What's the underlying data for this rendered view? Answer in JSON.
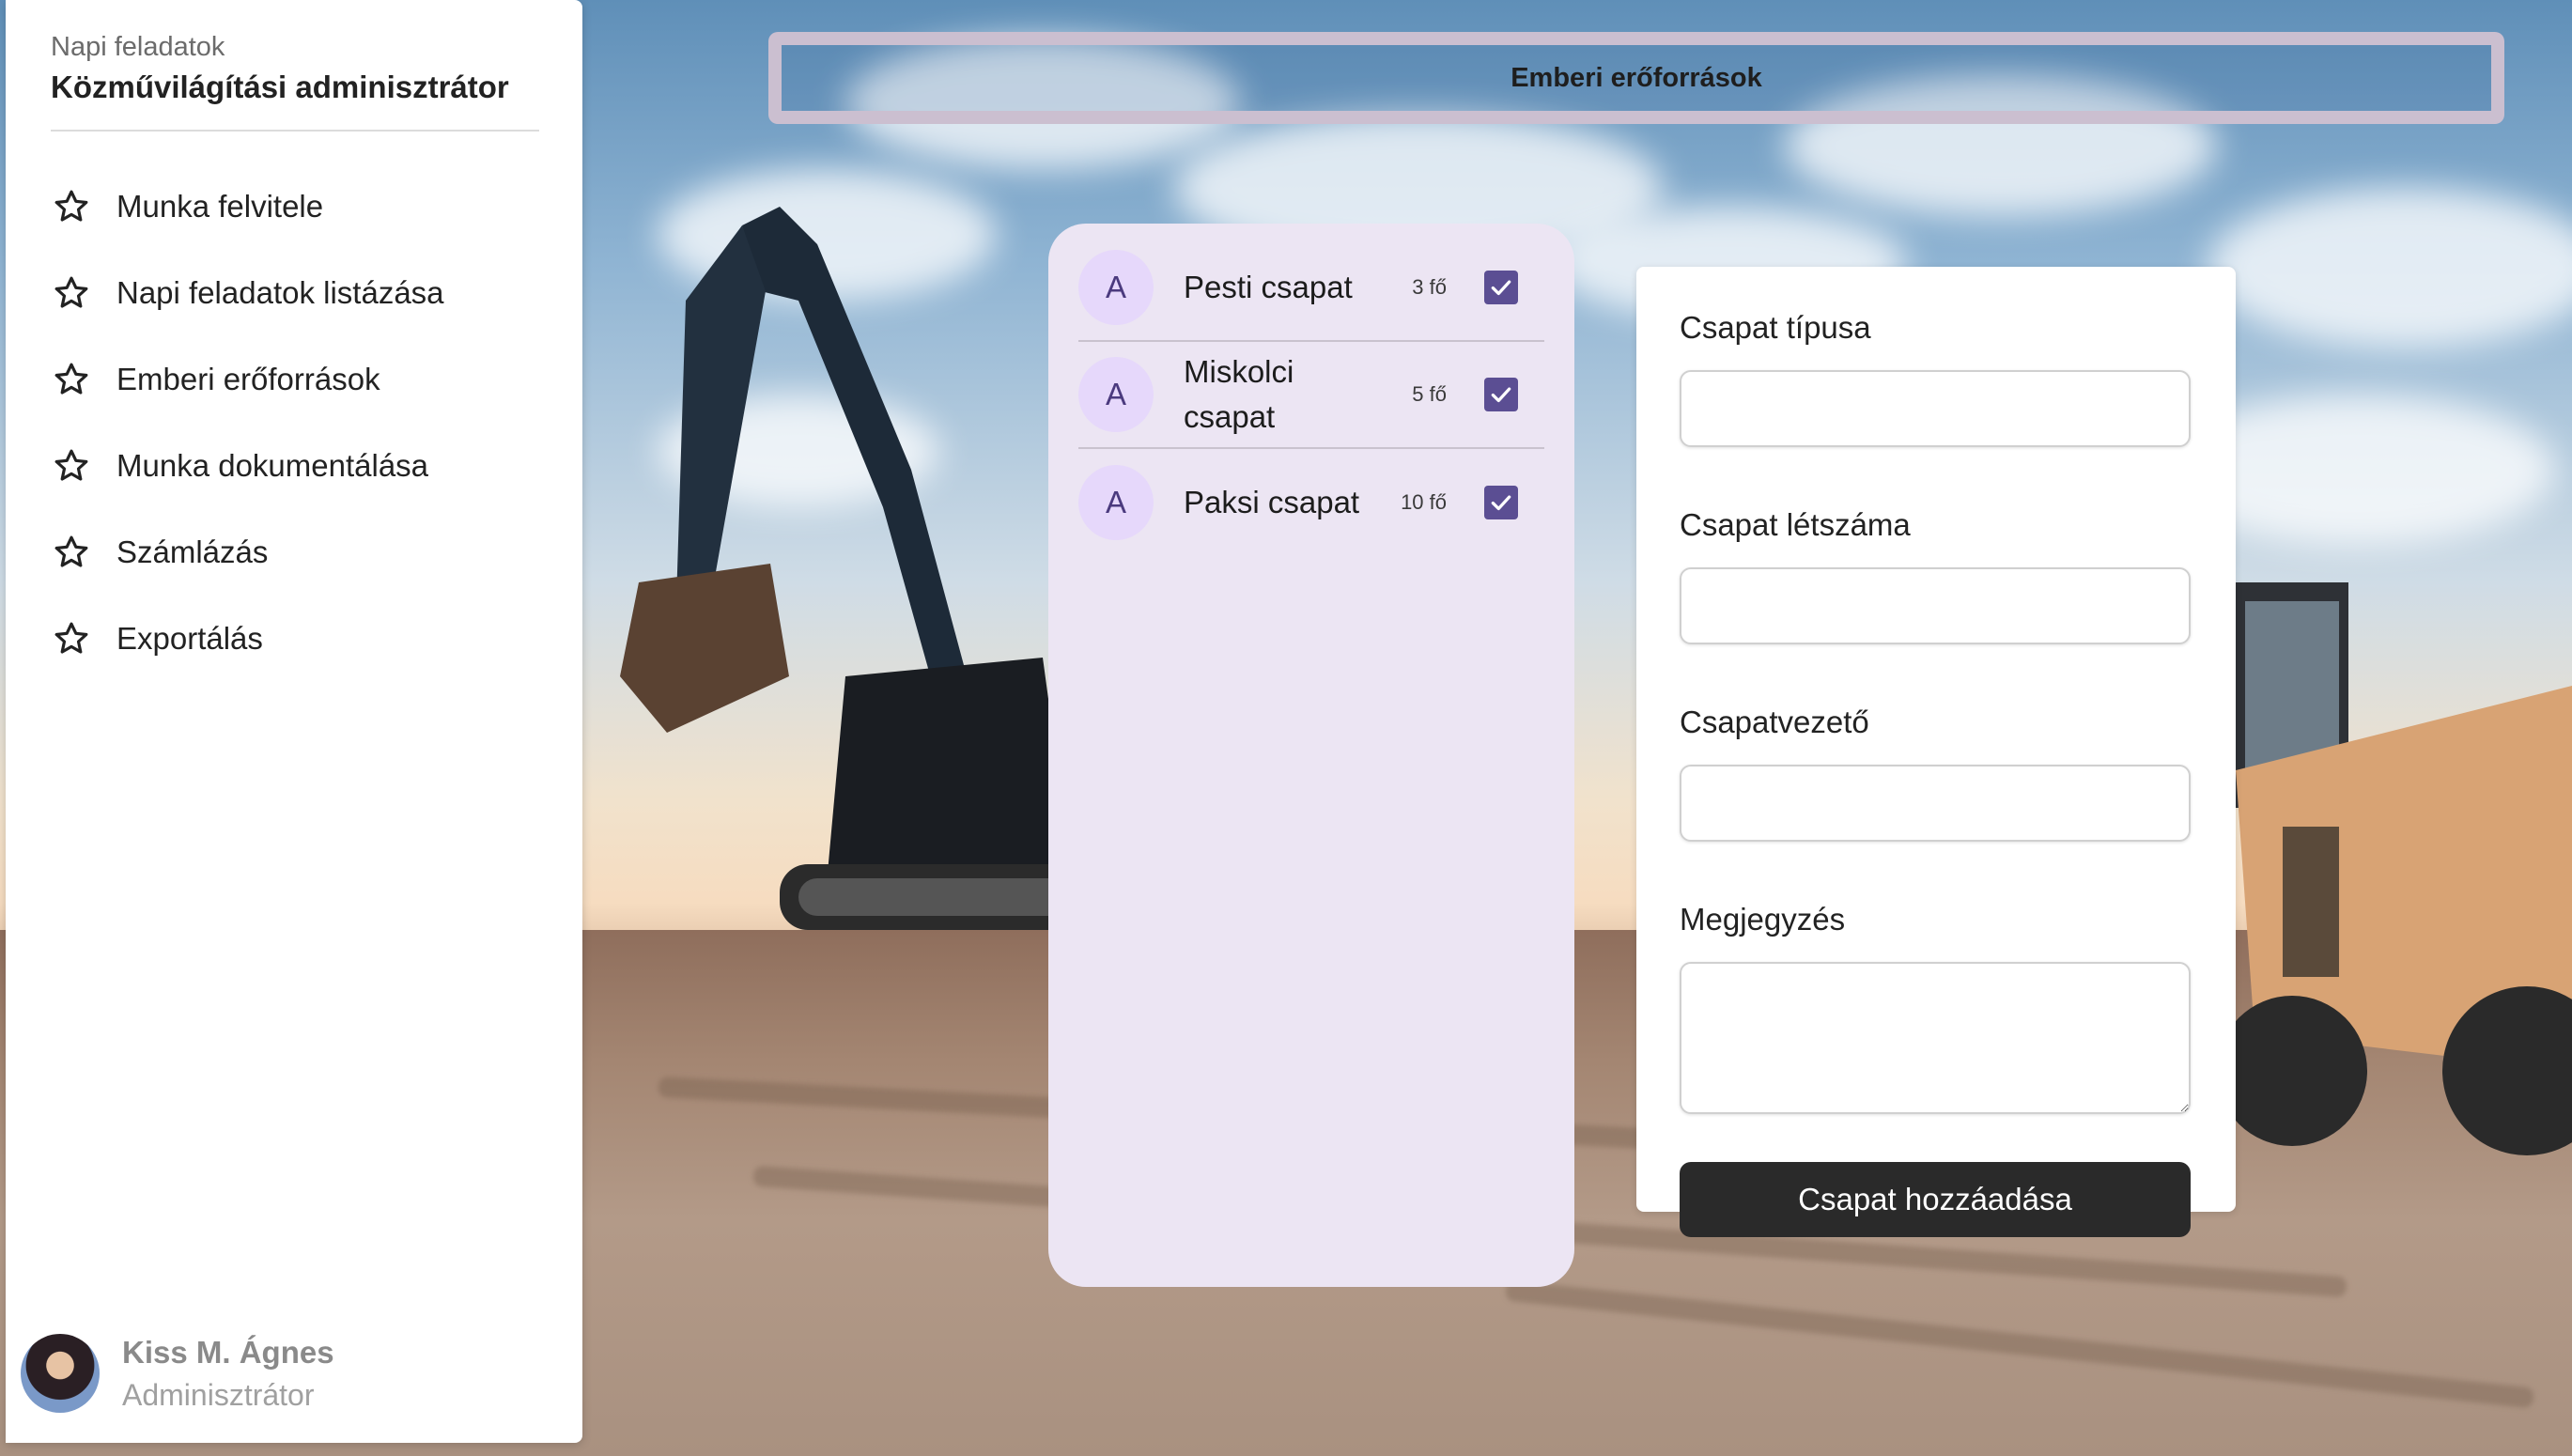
{
  "colors": {
    "accent": "#5b4e93",
    "list_background": "#ece5f3",
    "avatar_bg": "#e6d8fb",
    "button_bg": "#2a2a2a",
    "header_border": "#cbbfd0"
  },
  "sidebar": {
    "subtitle": "Napi feladatok",
    "title": "Közművilágítási adminisztrátor",
    "items": [
      {
        "label": "Munka felvitele",
        "icon": "star-icon"
      },
      {
        "label": "Napi feladatok listázása",
        "icon": "star-icon"
      },
      {
        "label": "Emberi erőforrások",
        "icon": "star-icon"
      },
      {
        "label": "Munka dokumentálása",
        "icon": "star-icon"
      },
      {
        "label": "Számlázás",
        "icon": "star-icon"
      },
      {
        "label": "Exportálás",
        "icon": "star-icon"
      }
    ],
    "user": {
      "name": "Kiss M. Ágnes",
      "role": "Adminisztrátor"
    }
  },
  "header": {
    "title": "Emberi erőforrások"
  },
  "teams": [
    {
      "avatar": "A",
      "name": "Pesti csapat",
      "count": "3 fő",
      "checked": true
    },
    {
      "avatar": "A",
      "name": "Miskolci csapat",
      "count": "5 fő",
      "checked": true
    },
    {
      "avatar": "A",
      "name": "Paksi csapat",
      "count": "10 fő",
      "checked": true
    }
  ],
  "form": {
    "type_label": "Csapat típusa",
    "type_value": "",
    "size_label": "Csapat létszáma",
    "size_value": "",
    "leader_label": "Csapatvezető",
    "leader_value": "",
    "note_label": "Megjegyzés",
    "note_value": "",
    "submit_label": "Csapat hozzáadása"
  }
}
